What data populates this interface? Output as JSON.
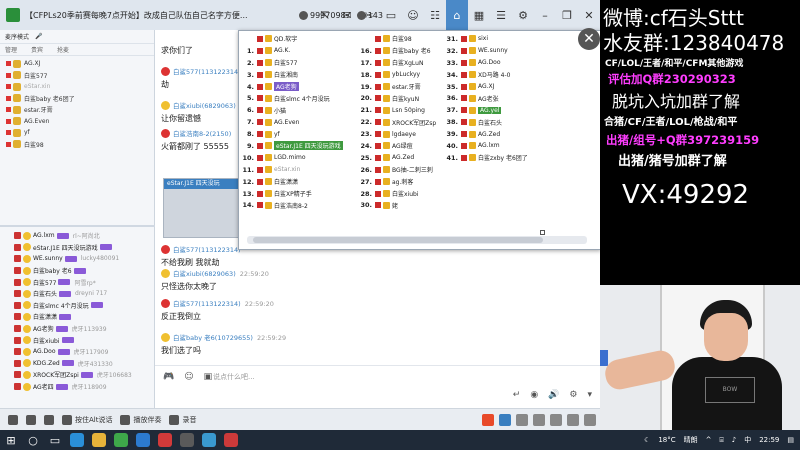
{
  "titlebar": {
    "title": "【CFPLs20季前赛每晚7点开始】改成自己队伍自己名字方便...",
    "viewers_count": "99970987",
    "online_count": "143",
    "icons": [
      "home-icon",
      "grid-icon",
      "settings-icon",
      "gear-icon",
      "minimize-icon",
      "restore-icon",
      "close-icon"
    ]
  },
  "left_panel": {
    "header_label": "麦序模式",
    "tabs": [
      "管理",
      "贵宾",
      "抢麦"
    ],
    "tree": [
      {
        "label": "AG.XJ",
        "dim": false
      },
      {
        "label": "白鲨577",
        "dim": false
      },
      {
        "label": "eStar.xin",
        "dim": true
      },
      {
        "label": "白鲨baby 老6团了",
        "dim": false
      },
      {
        "label": "estar.牙膏",
        "dim": false
      },
      {
        "label": "AG.Even",
        "dim": false
      },
      {
        "label": "yf",
        "dim": false
      },
      {
        "label": "白鲨98",
        "dim": false
      }
    ],
    "users": [
      {
        "name": "AG.lxm",
        "extra": "rl~阿尚北"
      },
      {
        "name": "eStar.J1E 四天没玩游戏",
        "extra": ""
      },
      {
        "name": "WE.sunny",
        "extra": "lucky480091"
      },
      {
        "name": "白鲨baby 老6",
        "extra": ""
      },
      {
        "name": "白鲨577",
        "extra": "阿雪rp*"
      },
      {
        "name": "白鲨石头",
        "extra": "dreyni 717"
      },
      {
        "name": "白鲨slmc 4个月没玩",
        "extra": ""
      },
      {
        "name": "白鲨潇潇",
        "extra": ""
      },
      {
        "name": "AG老狗",
        "extra": "虎牙113939"
      },
      {
        "name": "白鲨xiubi",
        "extra": ""
      },
      {
        "name": "AG.Doo",
        "extra": "虎牙117909"
      },
      {
        "name": "KDG.Zed",
        "extra": "虎牙431330"
      },
      {
        "name": "XROCK军团Zspi",
        "extra": "虎牙106683"
      },
      {
        "name": "AG老四",
        "extra": "虎牙118909"
      }
    ]
  },
  "chat": {
    "messages": [
      {
        "name": "",
        "time": "",
        "text": "求你们了"
      },
      {
        "name": "白鲨577(113122314)",
        "time": "",
        "text": "劫"
      },
      {
        "name": "白鲨xiubi(6829063)",
        "time": "",
        "text": "让你留遗憾"
      },
      {
        "name": "白鲨浩南8-2(2150)",
        "time": "",
        "text": "火箭都刚了 55555"
      },
      {
        "name": "eStar.J1E 四天没玩",
        "time": "",
        "text": ""
      },
      {
        "name": "白鲨577(113122314)",
        "time": "",
        "text": "不给我刷 我就劫"
      },
      {
        "name": "白鲨xiubi(6829063)",
        "time": "22:59:20",
        "text": "只怪选你太晚了"
      },
      {
        "name": "白鲨577(113122314)",
        "time": "22:59:20",
        "text": "反正我倒立"
      },
      {
        "name": "白鲨baby 老6(10729655)",
        "time": "22:59:29",
        "text": "我们选了吗"
      }
    ],
    "image_card_title": "eStar.J1E 四天没玩",
    "input_placeholder": "说点什么吧..."
  },
  "popup": {
    "columns": [
      [
        {
          "num": "",
          "label": "QD.软宇",
          "style": ""
        },
        {
          "num": "1.",
          "label": "AG.K.",
          "style": ""
        },
        {
          "num": "2.",
          "label": "白鲨577",
          "style": ""
        },
        {
          "num": "3.",
          "label": "白鲨湘南",
          "style": ""
        },
        {
          "num": "4.",
          "label": "AG老狗",
          "style": "hlr"
        },
        {
          "num": "5.",
          "label": "白鲨slmc 4个月没玩",
          "style": ""
        },
        {
          "num": "6.",
          "label": "小猫",
          "style": ""
        },
        {
          "num": "7.",
          "label": "AG.Even",
          "style": ""
        },
        {
          "num": "8.",
          "label": "yf",
          "style": ""
        },
        {
          "num": "9.",
          "label": "eStar.J1E 四天没玩游戏",
          "style": "hl"
        },
        {
          "num": "10.",
          "label": "LGD.mimo",
          "style": ""
        },
        {
          "num": "11.",
          "label": "eStar.xin",
          "style": "dim"
        },
        {
          "num": "12.",
          "label": "白鲨潇潇",
          "style": ""
        },
        {
          "num": "13.",
          "label": "白鲨XP精子手",
          "style": ""
        },
        {
          "num": "14.",
          "label": "白鲨浩南8-2",
          "style": ""
        }
      ],
      [
        {
          "num": "",
          "label": "白鲨98",
          "style": ""
        },
        {
          "num": "16.",
          "label": "白鲨baby 老6",
          "style": ""
        },
        {
          "num": "17.",
          "label": "白鲨XgLuN",
          "style": ""
        },
        {
          "num": "18.",
          "label": "ybLuckyy",
          "style": ""
        },
        {
          "num": "19.",
          "label": "estar.牙膏",
          "style": ""
        },
        {
          "num": "20.",
          "label": "白鲨kyuN",
          "style": ""
        },
        {
          "num": "21.",
          "label": "Lsn 50ping",
          "style": ""
        },
        {
          "num": "22.",
          "label": "XROCK军团Zsp",
          "style": ""
        },
        {
          "num": "23.",
          "label": "lgdaeye",
          "style": ""
        },
        {
          "num": "24.",
          "label": "AG绿痘",
          "style": ""
        },
        {
          "num": "25.",
          "label": "AG.Zed",
          "style": ""
        },
        {
          "num": "26.",
          "label": "BG抽-二刺三刺",
          "style": ""
        },
        {
          "num": "27.",
          "label": "ag.刺客",
          "style": ""
        },
        {
          "num": "28.",
          "label": "白鲨xiubi",
          "style": ""
        },
        {
          "num": "30.",
          "label": "姥",
          "style": ""
        }
      ],
      [
        {
          "num": "31.",
          "label": "sixi",
          "style": ""
        },
        {
          "num": "32.",
          "label": "WE.sunny",
          "style": ""
        },
        {
          "num": "33.",
          "label": "AG.Doo",
          "style": ""
        },
        {
          "num": "34.",
          "label": "XD马路 4-0",
          "style": ""
        },
        {
          "num": "35.",
          "label": "AG.XJ",
          "style": ""
        },
        {
          "num": "36.",
          "label": "AG老张",
          "style": ""
        },
        {
          "num": "37.",
          "label": "AG.yel",
          "style": "hl"
        },
        {
          "num": "38.",
          "label": "白鲨石头",
          "style": ""
        },
        {
          "num": "39.",
          "label": "AG.Zed",
          "style": ""
        },
        {
          "num": "40.",
          "label": "AG.lxm",
          "style": ""
        },
        {
          "num": "41.",
          "label": "白鲨zxby 老6团了",
          "style": ""
        }
      ]
    ]
  },
  "bottombar": {
    "items": [
      "按住Alt说话",
      "播放伴奏",
      "录音"
    ]
  },
  "taskbar": {
    "temperature": "18°C",
    "weather": "晴朗",
    "time": "22:59",
    "ime": "中"
  },
  "overlay": {
    "weibo": "微博:cf石头Sttt",
    "fans_group": "水友群:123840478",
    "games": "CF/LOL/王者/和平/CFM其他游戏",
    "eval_group": "评估加Q群230290323",
    "pit_group": "脱坑入坑加群了解",
    "services": "合猪/CF/王者/LOL/枪战/和平",
    "sell_group": "出猪/组号+Q群397239159",
    "sell_note": "出猪/猪号加群了解",
    "wechat": "VX:49292"
  },
  "webcam": {
    "shirt_print": "BOW"
  },
  "colors": {
    "accent_blue": "#4a89c8",
    "overlay_purple": "#ff3dff",
    "highlight_green": "#3f9a3f",
    "highlight_purple": "#7a5cc8"
  }
}
